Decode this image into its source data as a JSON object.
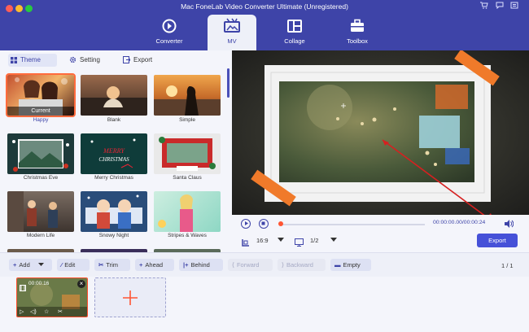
{
  "window": {
    "title": "Mac FoneLab Video Converter Ultimate (Unregistered)"
  },
  "nav": {
    "items": [
      {
        "label": "Converter",
        "icon": "converter-icon"
      },
      {
        "label": "MV",
        "icon": "mv-icon",
        "active": true
      },
      {
        "label": "Collage",
        "icon": "collage-icon"
      },
      {
        "label": "Toolbox",
        "icon": "toolbox-icon"
      }
    ]
  },
  "left_tabs": {
    "theme": "Theme",
    "setting": "Setting",
    "export": "Export"
  },
  "themes": {
    "current_badge": "Current",
    "items": [
      {
        "label": "Happy",
        "selected": true
      },
      {
        "label": "Blank"
      },
      {
        "label": "Simple"
      },
      {
        "label": "Christmas Eve"
      },
      {
        "label": "Merry Christmas"
      },
      {
        "label": "Santa Claus"
      },
      {
        "label": "Modern Life"
      },
      {
        "label": "Snowy Night"
      },
      {
        "label": "Stripes & Waves"
      }
    ]
  },
  "player": {
    "time": "00:00:00.00/00:00:24",
    "aspect_ratio": "16:9",
    "page": "1/2",
    "progress": 0.0,
    "export_label": "Export"
  },
  "toolbar": {
    "add": "Add",
    "edit": "Edit",
    "trim": "Trim",
    "ahead": "Ahead",
    "behind": "Behind",
    "forward": "Forward",
    "backward": "Backward",
    "empty": "Empty",
    "pager": "1 / 1"
  },
  "timeline": {
    "clip_duration": "00:00:16"
  },
  "colors": {
    "brand": "#3e44a8",
    "accent": "#ff5533",
    "export_button": "#4651d8"
  }
}
